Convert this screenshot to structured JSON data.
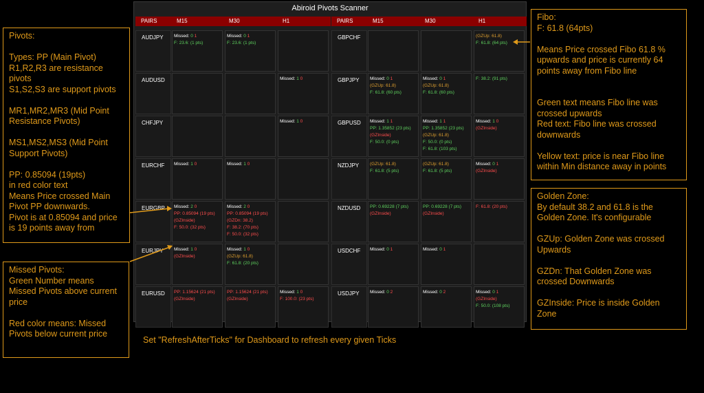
{
  "window": {
    "title": "Abiroid Pivots Scanner"
  },
  "columns": [
    "PAIRS",
    "M15",
    "M30",
    "H1"
  ],
  "left_rows": [
    {
      "pair": "AUDJPY",
      "cells": [
        [
          [
            {
              "t": "Missed: ",
              "c": "w"
            },
            {
              "t": "0 ",
              "c": "g"
            },
            {
              "t": "1",
              "c": "r"
            }
          ],
          [
            {
              "t": "F: 23.6: (1 pts)",
              "c": "g"
            }
          ]
        ],
        [
          [
            {
              "t": "Missed: ",
              "c": "w"
            },
            {
              "t": "0 ",
              "c": "g"
            },
            {
              "t": "1",
              "c": "r"
            }
          ],
          [
            {
              "t": "F: 23.6: (1 pts)",
              "c": "g"
            }
          ]
        ],
        []
      ]
    },
    {
      "pair": "AUDUSD",
      "cells": [
        [],
        [],
        [
          [
            {
              "t": "Missed: ",
              "c": "w"
            },
            {
              "t": "1 ",
              "c": "g"
            },
            {
              "t": "0",
              "c": "r"
            }
          ]
        ]
      ]
    },
    {
      "pair": "CHFJPY",
      "cells": [
        [],
        [],
        [
          [
            {
              "t": "Missed: ",
              "c": "w"
            },
            {
              "t": "1 ",
              "c": "g"
            },
            {
              "t": "0",
              "c": "r"
            }
          ]
        ]
      ]
    },
    {
      "pair": "EURCHF",
      "cells": [
        [
          [
            {
              "t": "Missed: ",
              "c": "w"
            },
            {
              "t": "1 ",
              "c": "g"
            },
            {
              "t": "0",
              "c": "r"
            }
          ]
        ],
        [
          [
            {
              "t": "Missed: ",
              "c": "w"
            },
            {
              "t": "1 ",
              "c": "g"
            },
            {
              "t": "0",
              "c": "r"
            }
          ]
        ],
        []
      ]
    },
    {
      "pair": "EURGBP",
      "cells": [
        [
          [
            {
              "t": "Missed: ",
              "c": "w"
            },
            {
              "t": "2 ",
              "c": "g"
            },
            {
              "t": "0",
              "c": "r"
            }
          ],
          [
            {
              "t": "PP: 0.85094 (19 pts)",
              "c": "r"
            }
          ],
          [
            {
              "t": "(GZInside)",
              "c": "r"
            }
          ],
          [
            {
              "t": "F: 50.0: (32 pts)",
              "c": "r"
            }
          ]
        ],
        [
          [
            {
              "t": "Missed: ",
              "c": "w"
            },
            {
              "t": "2 ",
              "c": "g"
            },
            {
              "t": "0",
              "c": "r"
            }
          ],
          [
            {
              "t": "PP: 0.85094 (19 pts)",
              "c": "r"
            }
          ],
          [
            {
              "t": "(GZDn: 38.2)",
              "c": "r"
            }
          ],
          [
            {
              "t": "F: 38.2: (70 pts)",
              "c": "r"
            }
          ],
          [
            {
              "t": "F: 50.0: (32 pts)",
              "c": "r"
            }
          ]
        ],
        []
      ]
    },
    {
      "pair": "EURJPY",
      "cells": [
        [
          [
            {
              "t": "Missed: ",
              "c": "w"
            },
            {
              "t": "1 ",
              "c": "g"
            },
            {
              "t": "0",
              "c": "r"
            }
          ],
          [
            {
              "t": "(GZInside)",
              "c": "r"
            }
          ]
        ],
        [
          [
            {
              "t": "Missed: ",
              "c": "w"
            },
            {
              "t": "1 ",
              "c": "g"
            },
            {
              "t": "0",
              "c": "r"
            }
          ],
          [
            {
              "t": "(GZUp: 61.8)",
              "c": "y"
            }
          ],
          [
            {
              "t": "F: 61.8: (20 pts)",
              "c": "g"
            }
          ]
        ],
        []
      ]
    },
    {
      "pair": "EURUSD",
      "cells": [
        [
          [
            {
              "t": "PP: 1.15624 (21 pts)",
              "c": "r"
            }
          ],
          [
            {
              "t": "(GZInside)",
              "c": "r"
            }
          ]
        ],
        [
          [
            {
              "t": "PP: 1.15624 (21 pts)",
              "c": "r"
            }
          ],
          [
            {
              "t": "(GZInside)",
              "c": "r"
            }
          ]
        ],
        [
          [
            {
              "t": "Missed: ",
              "c": "w"
            },
            {
              "t": "1 ",
              "c": "g"
            },
            {
              "t": "0",
              "c": "r"
            }
          ],
          [
            {
              "t": "F: 100.0: (23 pts)",
              "c": "r"
            }
          ]
        ]
      ]
    }
  ],
  "right_rows": [
    {
      "pair": "GBPCHF",
      "cells": [
        [],
        [],
        [
          [
            {
              "t": "(GZUp: 61.8)",
              "c": "y"
            }
          ],
          [
            {
              "t": "F: 61.8: (64 pts)",
              "c": "g"
            }
          ]
        ]
      ]
    },
    {
      "pair": "GBPJPY",
      "cells": [
        [
          [
            {
              "t": "Missed: ",
              "c": "w"
            },
            {
              "t": "0 ",
              "c": "g"
            },
            {
              "t": "1",
              "c": "r"
            }
          ],
          [
            {
              "t": "(GZUp: 61.8)",
              "c": "y"
            }
          ],
          [
            {
              "t": "F: 61.8: (60 pts)",
              "c": "g"
            }
          ]
        ],
        [
          [
            {
              "t": "Missed: ",
              "c": "w"
            },
            {
              "t": "0 ",
              "c": "g"
            },
            {
              "t": "1",
              "c": "r"
            }
          ],
          [
            {
              "t": "(GZUp: 61.8)",
              "c": "y"
            }
          ],
          [
            {
              "t": "F: 61.8: (60 pts)",
              "c": "g"
            }
          ]
        ],
        [
          [
            {
              "t": "F: 38.2: (91 pts)",
              "c": "g"
            }
          ]
        ]
      ]
    },
    {
      "pair": "GBPUSD",
      "cells": [
        [
          [
            {
              "t": "Missed: ",
              "c": "w"
            },
            {
              "t": "1 ",
              "c": "g"
            },
            {
              "t": "1",
              "c": "r"
            }
          ],
          [
            {
              "t": "PP: 1.35852 (23 pts)",
              "c": "g"
            }
          ],
          [
            {
              "t": "(GZInside)",
              "c": "r"
            }
          ],
          [
            {
              "t": "F: 50.0: (0 pts)",
              "c": "g"
            }
          ]
        ],
        [
          [
            {
              "t": "Missed: ",
              "c": "w"
            },
            {
              "t": "1 ",
              "c": "g"
            },
            {
              "t": "1",
              "c": "r"
            }
          ],
          [
            {
              "t": "PP: 1.35852 (23 pts)",
              "c": "g"
            }
          ],
          [
            {
              "t": "(GZUp: 61.8)",
              "c": "y"
            }
          ],
          [
            {
              "t": "F: 50.0: (0 pts)",
              "c": "g"
            }
          ],
          [
            {
              "t": "F: 61.8: (103 pts)",
              "c": "g"
            }
          ]
        ],
        [
          [
            {
              "t": "Missed: ",
              "c": "w"
            },
            {
              "t": "1 ",
              "c": "g"
            },
            {
              "t": "0",
              "c": "r"
            }
          ],
          [
            {
              "t": "(GZInside)",
              "c": "r"
            }
          ]
        ]
      ]
    },
    {
      "pair": "NZDJPY",
      "cells": [
        [
          [
            {
              "t": "(GZUp: 61.8)",
              "c": "y"
            }
          ],
          [
            {
              "t": "F: 61.8: (5 pts)",
              "c": "g"
            }
          ]
        ],
        [
          [
            {
              "t": "(GZUp: 61.8)",
              "c": "y"
            }
          ],
          [
            {
              "t": "F: 61.8: (5 pts)",
              "c": "g"
            }
          ]
        ],
        [
          [
            {
              "t": "Missed: ",
              "c": "w"
            },
            {
              "t": "0 ",
              "c": "g"
            },
            {
              "t": "1",
              "c": "r"
            }
          ],
          [
            {
              "t": "(GZInside)",
              "c": "r"
            }
          ]
        ]
      ]
    },
    {
      "pair": "NZDUSD",
      "cells": [
        [
          [
            {
              "t": "PP: 0.69228 (7 pts)",
              "c": "g"
            }
          ],
          [
            {
              "t": "(GZInside)",
              "c": "r"
            }
          ]
        ],
        [
          [
            {
              "t": "PP: 0.69228 (7 pts)",
              "c": "g"
            }
          ],
          [
            {
              "t": "(GZInside)",
              "c": "r"
            }
          ]
        ],
        [
          [
            {
              "t": "F: 61.8: (20 pts)",
              "c": "r"
            }
          ]
        ]
      ]
    },
    {
      "pair": "USDCHF",
      "cells": [
        [
          [
            {
              "t": "Missed: ",
              "c": "w"
            },
            {
              "t": "0 ",
              "c": "g"
            },
            {
              "t": "1",
              "c": "r"
            }
          ]
        ],
        [
          [
            {
              "t": "Missed: ",
              "c": "w"
            },
            {
              "t": "0 ",
              "c": "g"
            },
            {
              "t": "1",
              "c": "r"
            }
          ]
        ],
        []
      ]
    },
    {
      "pair": "USDJPY",
      "cells": [
        [
          [
            {
              "t": "Missed: ",
              "c": "w"
            },
            {
              "t": "0 ",
              "c": "g"
            },
            {
              "t": "2",
              "c": "r"
            }
          ]
        ],
        [
          [
            {
              "t": "Missed: ",
              "c": "w"
            },
            {
              "t": "0 ",
              "c": "g"
            },
            {
              "t": "2",
              "c": "r"
            }
          ]
        ],
        [
          [
            {
              "t": "Missed: ",
              "c": "w"
            },
            {
              "t": "0 ",
              "c": "g"
            },
            {
              "t": "1",
              "c": "r"
            }
          ],
          [
            {
              "t": "(GZInside)",
              "c": "r"
            }
          ],
          [
            {
              "t": "F: 50.0: (108 pts)",
              "c": "g"
            }
          ]
        ]
      ]
    }
  ],
  "annotations": {
    "pivots": "Pivots:\n\nTypes: PP (Main Pivot)\nR1,R2,R3 are resistance pivots\nS1,S2,S3 are support pivots\n\nMR1,MR2,MR3 (Mid Point Resistance Pivots)\n\nMS1,MS2,MS3 (Mid Point Support Pivots)\n\nPP: 0.85094 (19pts)\nin red color text\nMeans Price crossed Main Pivot PP downwards.\nPivot is at 0.85094 and price is 19 points away from",
    "missed": "Missed Pivots:\nGreen Number means Missed Pivots above current price\n\nRed color means: Missed Pivots below current price",
    "fibo": "Fibo:\nF: 61.8 (64pts)\n\nMeans Price crossed Fibo 61.8 % upwards and price is currently 64 points away from Fibo line\n\n\nGreen text means Fibo line was crossed upwards\nRed text: Fibo line was crossed downwards\n\nYellow text: price is near Fibo line within Min distance away in points",
    "golden": "Golden Zone:\nBy default 38.2 and 61.8 is the Golden Zone. It's configurable\n\nGZUp: Golden Zone was crossed Upwards\n\nGZDn: That Golden Zone was crossed Downwards\n\nGZInside: Price is inside Golden Zone"
  },
  "footer": "Set \"RefreshAfterTicks\" for Dashboard to refresh every given Ticks",
  "colors": {
    "accent": "#e09a1a",
    "header": "#8b0000",
    "green": "#5fd35f",
    "red": "#ff4d4d",
    "yellow": "#e0a030"
  }
}
